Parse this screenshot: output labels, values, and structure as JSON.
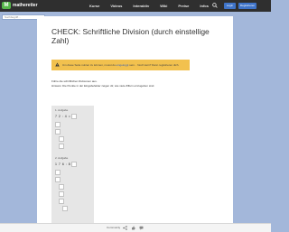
{
  "header": {
    "logo_mark": "M",
    "logo_text": "matheretter",
    "nav": [
      "Kurse",
      "Videos",
      "Interaktiv",
      "Wiki",
      "Preise",
      "Infos"
    ],
    "login_label": "Login",
    "register_label": "Registrieren"
  },
  "search": {
    "placeholder": "Suchbegriff..."
  },
  "page": {
    "title": "CHECK: Schriftliche Division (durch einstellige Zahl)",
    "notice_text": "Um diese Seite nutzen zu können, musst du",
    "notice_link": "eingeloggt",
    "notice_rest": "sein. · Noch kein? Dann registrieren dich.",
    "intro_line1": "Führe die schriftlichen Divisionen aus.",
    "intro_line2": "Hinweis: Die Punkte in der Eingabefelder zeigen dir, wie viele Ziffern einzugeben sind."
  },
  "exercises": [
    {
      "label": "1. Aufgabe",
      "expression": "7 2 : 4  ="
    },
    {
      "label": "2. Aufgabe",
      "expression": "1 7 6 : 8  ="
    }
  ],
  "footer": {
    "community_label": "Community"
  },
  "colors": {
    "topbar": "#2f2f2f",
    "background": "#a3b7da",
    "notice": "#f2c14e",
    "accent": "#56b64a",
    "button": "#3f74c9"
  }
}
